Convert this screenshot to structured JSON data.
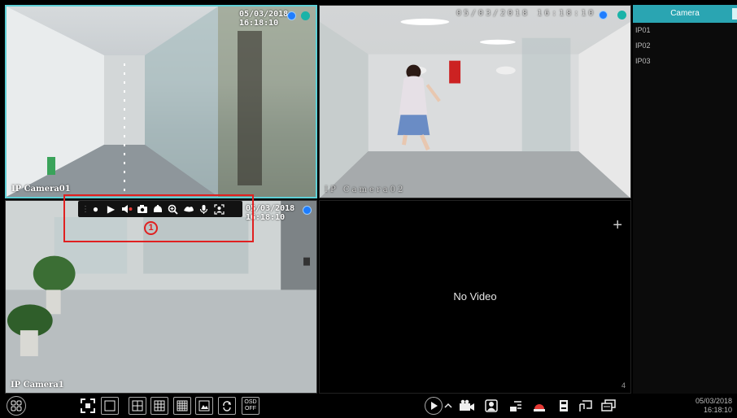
{
  "tiles": [
    {
      "date": "05/03/2018 16:18:10",
      "name": "IP Camera01"
    },
    {
      "date": "05/03/2018 16:18:10",
      "name": "IP Camera02"
    },
    {
      "date": "05/03/2018 16:18:10",
      "name": "IP Camera1"
    },
    {
      "no_video": "No Video",
      "number": "4",
      "add": "+"
    }
  ],
  "callout": {
    "number": "1"
  },
  "panel": {
    "tab_label": "Camera",
    "cameras": [
      "IP01",
      "IP02",
      "IP03"
    ]
  },
  "taskbar": {
    "osd_label": "OSD",
    "osd_state": "OFF",
    "clock_date": "05/03/2018",
    "clock_time": "16:18:10"
  },
  "colors": {
    "accent": "#2aa5b2",
    "selected_border": "#5fd0d6",
    "callout": "#e02020",
    "alarm": "#e53935"
  }
}
